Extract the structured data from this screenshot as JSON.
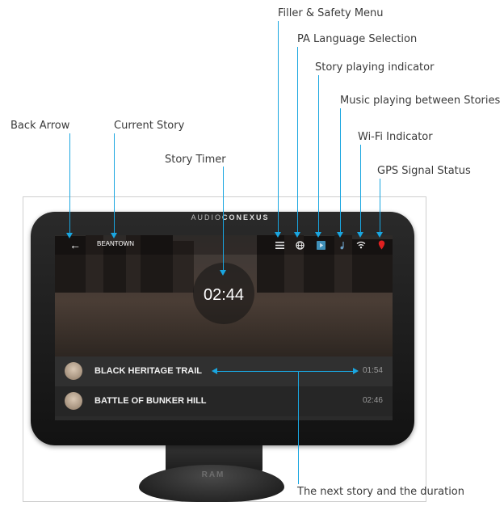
{
  "annotations": {
    "filler_safety_menu": "Filler & Safety Menu",
    "pa_language_selection": "PA Language Selection",
    "story_playing_indicator": "Story playing indicator",
    "music_playing": "Music playing between Stories",
    "back_arrow": "Back Arrow",
    "current_story": "Current Story",
    "wifi_indicator": "Wi-Fi Indicator",
    "story_timer": "Story Timer",
    "gps_signal_status": "GPS Signal Status",
    "next_story": "The next story and the duration"
  },
  "device": {
    "brand_prefix": "AUDIO",
    "brand_suffix": "CONEXUS",
    "mount_logo": "RAM"
  },
  "screen": {
    "back_glyph": "←",
    "current_story": "BEANTOWN",
    "timer": "02:44",
    "icons": [
      "hamburger-menu-icon",
      "globe-icon",
      "play-icon",
      "music-note-icon",
      "wifi-icon",
      "gps-icon"
    ],
    "stories": [
      {
        "title": "BLACK HERITAGE TRAIL",
        "duration": "01:54"
      },
      {
        "title": "BATTLE OF BUNKER HILL",
        "duration": "02:46"
      }
    ]
  },
  "colors": {
    "accent": "#1aa6e0",
    "gps_status": "#e02020",
    "play_indicator": "#3f8fb8"
  }
}
